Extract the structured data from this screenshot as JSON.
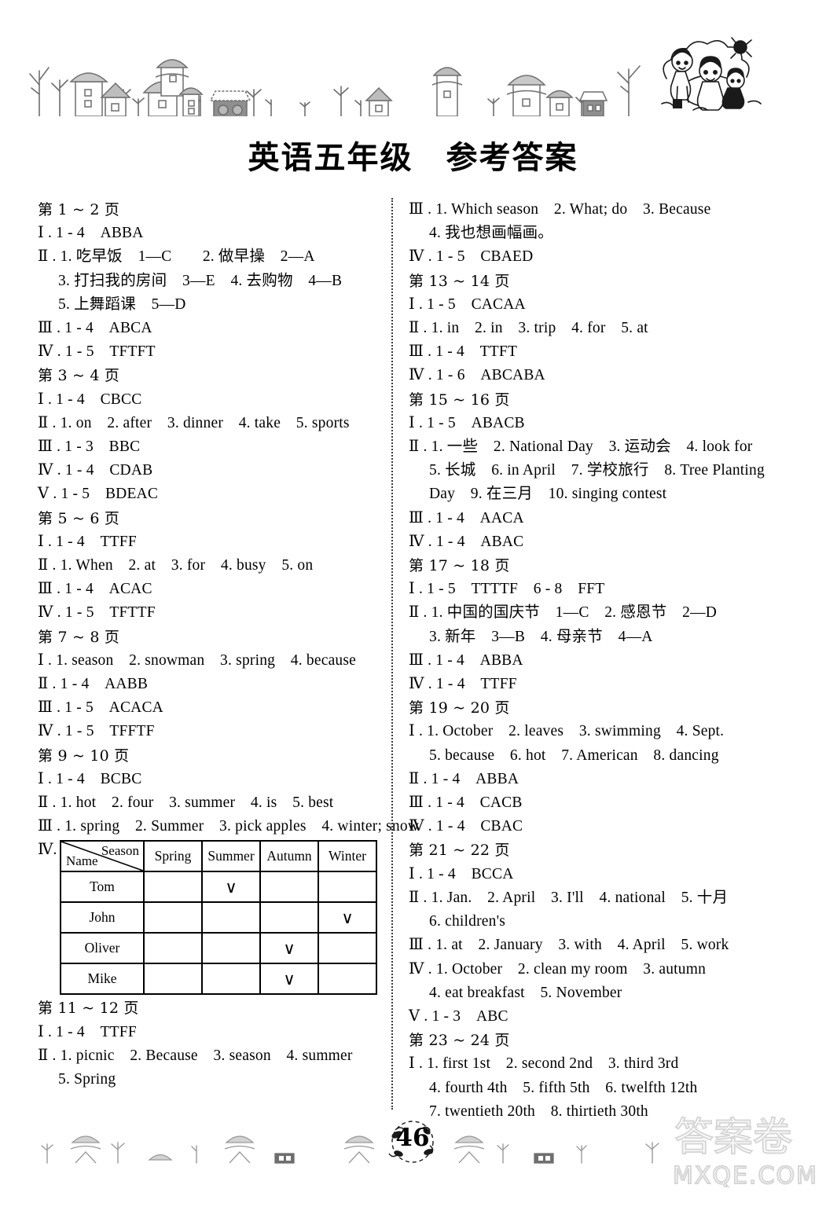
{
  "document": {
    "title": "英语五年级　参考答案",
    "page_number": "46",
    "watermark": {
      "chinese": "答案卷",
      "site": "MXQE.COM"
    }
  },
  "left_column": [
    {
      "type": "pagehead",
      "text": "第 1 ~ 2 页"
    },
    {
      "type": "answer",
      "text": "Ⅰ . 1 - 4　ABBA"
    },
    {
      "type": "answer",
      "text": "Ⅱ . 1. 吃早饭　1—C　　2. 做早操　2—A"
    },
    {
      "type": "indent",
      "text": "3. 打扫我的房间　3—E　4. 去购物　4—B"
    },
    {
      "type": "indent",
      "text": "5. 上舞蹈课　5—D"
    },
    {
      "type": "answer",
      "text": "Ⅲ . 1 - 4　ABCA"
    },
    {
      "type": "answer",
      "text": "Ⅳ . 1 - 5　TFTFT"
    },
    {
      "type": "pagehead",
      "text": "第 3 ~ 4 页"
    },
    {
      "type": "answer",
      "text": "Ⅰ . 1 - 4　CBCC"
    },
    {
      "type": "answer",
      "text": "Ⅱ . 1. on　2. after　3. dinner　4. take　5. sports"
    },
    {
      "type": "answer",
      "text": "Ⅲ . 1 - 3　BBC"
    },
    {
      "type": "answer",
      "text": "Ⅳ . 1 - 4　CDAB"
    },
    {
      "type": "answer",
      "text": "Ⅴ . 1 - 5　BDEAC"
    },
    {
      "type": "pagehead",
      "text": "第 5 ~ 6 页"
    },
    {
      "type": "answer",
      "text": "Ⅰ . 1 - 4　TTFF"
    },
    {
      "type": "answer",
      "text": "Ⅱ . 1. When　2. at　3. for　4. busy　5. on"
    },
    {
      "type": "answer",
      "text": "Ⅲ . 1 - 4　ACAC"
    },
    {
      "type": "answer",
      "text": "Ⅳ . 1 - 5　TFTTF"
    },
    {
      "type": "pagehead",
      "text": "第 7 ~ 8 页"
    },
    {
      "type": "answer",
      "text": "Ⅰ . 1. season　2. snowman　3. spring　4. because"
    },
    {
      "type": "answer",
      "text": "Ⅱ . 1 - 4　AABB"
    },
    {
      "type": "answer",
      "text": "Ⅲ . 1 - 5　ACACA"
    },
    {
      "type": "answer",
      "text": "Ⅳ . 1 - 5　TFFTF"
    },
    {
      "type": "pagehead",
      "text": "第 9 ~ 10 页"
    },
    {
      "type": "answer",
      "text": "Ⅰ . 1 - 4　BCBC"
    },
    {
      "type": "answer",
      "text": "Ⅱ . 1. hot　2. four　3. summer　4. is　5. best"
    },
    {
      "type": "answer",
      "text": "Ⅲ . 1. spring　2. Summer　3. pick apples　4. winter; snow"
    },
    {
      "type": "table",
      "marker": "Ⅳ."
    },
    {
      "type": "pagehead",
      "text": "第 11 ~ 12 页"
    },
    {
      "type": "answer",
      "text": "Ⅰ . 1 - 4　TTFF"
    },
    {
      "type": "answer",
      "text": "Ⅱ . 1. picnic　2. Because　3. season　4. summer"
    },
    {
      "type": "indent",
      "text": "5. Spring"
    }
  ],
  "season_table": {
    "corner_row_label": "Name",
    "corner_col_label": "Season",
    "columns": [
      "Spring",
      "Summer",
      "Autumn",
      "Winter"
    ],
    "rows": [
      {
        "name": "Tom",
        "marks": [
          false,
          true,
          false,
          false
        ]
      },
      {
        "name": "John",
        "marks": [
          false,
          false,
          false,
          true
        ]
      },
      {
        "name": "Oliver",
        "marks": [
          false,
          false,
          true,
          false
        ]
      },
      {
        "name": "Mike",
        "marks": [
          false,
          false,
          true,
          false
        ]
      }
    ],
    "tick_glyph": "∨"
  },
  "right_column": [
    {
      "type": "answer",
      "text": "Ⅲ . 1. Which season　2. What; do　3. Because"
    },
    {
      "type": "indent",
      "text": "4. 我也想画幅画。"
    },
    {
      "type": "answer",
      "text": "Ⅳ . 1 - 5　CBAED"
    },
    {
      "type": "pagehead",
      "text": "第 13 ~ 14 页"
    },
    {
      "type": "answer",
      "text": "Ⅰ . 1 - 5　CACAA"
    },
    {
      "type": "answer",
      "text": "Ⅱ . 1. in　2. in　3. trip　4. for　5. at"
    },
    {
      "type": "answer",
      "text": "Ⅲ . 1 - 4　TTFT"
    },
    {
      "type": "answer",
      "text": "Ⅳ . 1 - 6　ABCABA"
    },
    {
      "type": "pagehead",
      "text": "第 15 ~ 16 页"
    },
    {
      "type": "answer",
      "text": "Ⅰ . 1 - 5　ABACB"
    },
    {
      "type": "answer",
      "text": "Ⅱ . 1. 一些　2. National Day　3. 运动会　4. look for"
    },
    {
      "type": "indent",
      "text": "5. 长城　6. in April　7. 学校旅行　8. Tree Planting"
    },
    {
      "type": "indent",
      "text": "Day　9. 在三月　10. singing contest"
    },
    {
      "type": "answer",
      "text": "Ⅲ . 1 - 4　AACA"
    },
    {
      "type": "answer",
      "text": "Ⅳ . 1 - 4　ABAC"
    },
    {
      "type": "pagehead",
      "text": "第 17 ~ 18 页"
    },
    {
      "type": "answer",
      "text": "Ⅰ . 1 - 5　TTTTF　6 - 8　FFT"
    },
    {
      "type": "answer",
      "text": "Ⅱ . 1. 中国的国庆节　1—C　2. 感恩节　2—D"
    },
    {
      "type": "indent",
      "text": "3. 新年　3—B　4. 母亲节　4—A"
    },
    {
      "type": "answer",
      "text": "Ⅲ . 1 - 4　ABBA"
    },
    {
      "type": "answer",
      "text": "Ⅳ . 1 - 4　TTFF"
    },
    {
      "type": "pagehead",
      "text": "第 19 ~ 20 页"
    },
    {
      "type": "answer",
      "text": "Ⅰ . 1. October　2. leaves　3. swimming　4. Sept."
    },
    {
      "type": "indent",
      "text": "5. because　6. hot　7. American　8. dancing"
    },
    {
      "type": "answer",
      "text": "Ⅱ . 1 - 4　ABBA"
    },
    {
      "type": "answer",
      "text": "Ⅲ . 1 - 4　CACB"
    },
    {
      "type": "answer",
      "text": "Ⅳ . 1 - 4　CBAC"
    },
    {
      "type": "pagehead",
      "text": "第 21 ~ 22 页"
    },
    {
      "type": "answer",
      "text": "Ⅰ . 1 - 4　BCCA"
    },
    {
      "type": "answer",
      "text": "Ⅱ . 1. Jan.　2. April　3. I'll　4. national　5. 十月"
    },
    {
      "type": "indent",
      "text": "6. children's"
    },
    {
      "type": "answer",
      "text": "Ⅲ . 1. at　2. January　3. with　4. April　5. work"
    },
    {
      "type": "answer",
      "text": "Ⅳ . 1. October　2. clean my room　3. autumn"
    },
    {
      "type": "indent",
      "text": "4. eat breakfast　5. November"
    },
    {
      "type": "answer",
      "text": "Ⅴ . 1 - 3　ABC"
    },
    {
      "type": "pagehead",
      "text": "第 23 ~ 24 页"
    },
    {
      "type": "answer",
      "text": "Ⅰ . 1. first 1st　2. second 2nd　3. third 3rd"
    },
    {
      "type": "indent",
      "text": "4. fourth 4th　5. fifth 5th　6. twelfth 12th"
    },
    {
      "type": "indent",
      "text": "7. twentieth 20th　8. thirtieth 30th"
    }
  ]
}
